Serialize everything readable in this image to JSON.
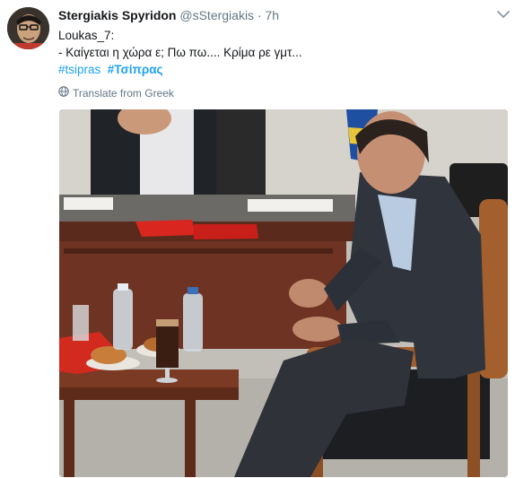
{
  "tweet": {
    "author_name": "Stergiakis Spyridon",
    "author_handle": "@sStergiakis",
    "separator": "·",
    "time": "7h",
    "text_line1": "Loukas_7:",
    "text_line2": "- Καίγεται η χώρα ε; Πω πω.... Κρίμα ρε γμτ...",
    "hashtag1": "#tsipras",
    "hashtag2": "#Τσίπρας",
    "translate_label": "Translate from Greek"
  },
  "icons": {
    "caret": "chevron-down-icon",
    "globe": "globe-icon"
  },
  "colors": {
    "link": "#1da1f2",
    "secondary_text": "#657786",
    "primary_text": "#14171a"
  }
}
